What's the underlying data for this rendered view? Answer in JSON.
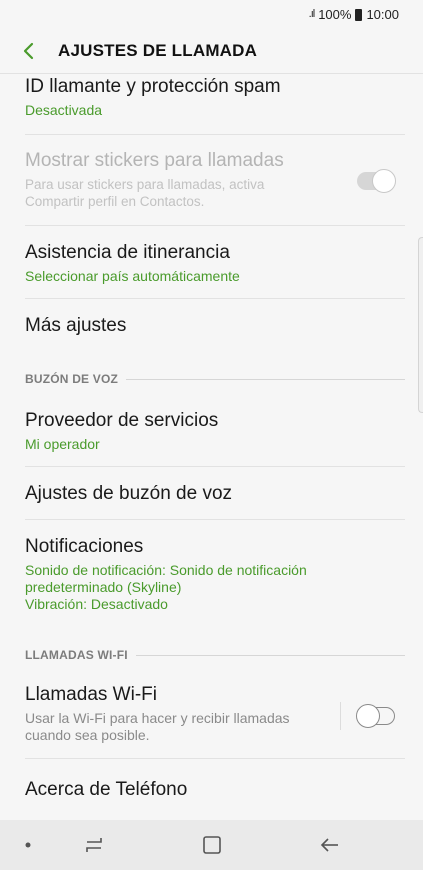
{
  "status_bar": {
    "signal": ".ıl",
    "battery_percent": "100%",
    "time": "10:00"
  },
  "app_bar": {
    "title": "AJUSTES DE LLAMADA"
  },
  "items": {
    "caller_id": {
      "title": "ID llamante y protección spam",
      "subtitle": "Desactivada"
    },
    "stickers": {
      "title": "Mostrar stickers para llamadas",
      "subtitle_line1": "Para usar stickers para llamadas, activa",
      "subtitle_line2": "Compartir perfil en Contactos.",
      "toggle": "on-disabled"
    },
    "roaming": {
      "title": "Asistencia de itinerancia",
      "subtitle": "Seleccionar país automáticamente"
    },
    "more": {
      "title": "Más ajustes"
    },
    "provider": {
      "title": "Proveedor de servicios",
      "subtitle": "Mi operador"
    },
    "voicemail_settings": {
      "title": "Ajustes de buzón de voz"
    },
    "notifications": {
      "title": "Notificaciones",
      "subtitle_line1": "Sonido de notificación: Sonido de notificación",
      "subtitle_line2": "predeterminado (Skyline)",
      "subtitle_line3": "Vibración: Desactivado"
    },
    "wifi_calling": {
      "title": "Llamadas Wi-Fi",
      "subtitle_line1": "Usar la Wi-Fi para hacer y recibir llamadas",
      "subtitle_line2": "cuando sea posible.",
      "toggle": "off"
    },
    "about": {
      "title": "Acerca de Teléfono"
    }
  },
  "sections": {
    "voicemail": "BUZÓN DE VOZ",
    "wifi": "LLAMADAS WI-FI"
  },
  "colors": {
    "accent_green": "#4a9b2c",
    "background": "#f6f6f6",
    "nav_bar": "#eaeaea"
  },
  "icons": {
    "back": "chevron-left-icon",
    "nav_dot": "dot-icon",
    "recents": "recents-icon",
    "home": "home-icon",
    "nav_back": "arrow-left-icon"
  }
}
